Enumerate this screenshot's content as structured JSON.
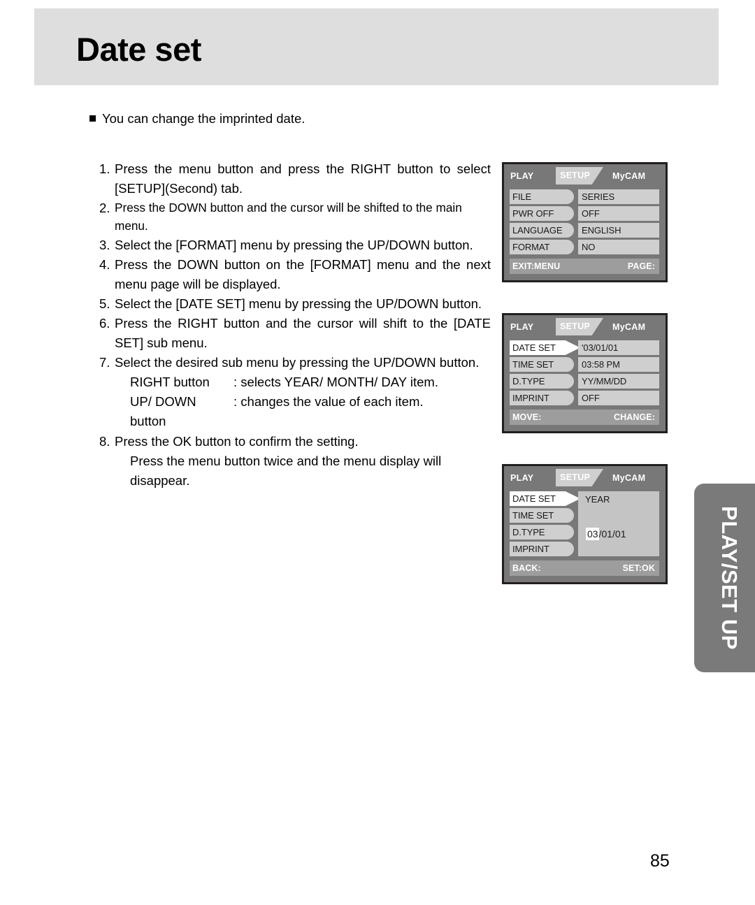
{
  "header": {
    "title": "Date set"
  },
  "intro": {
    "bullet_icon": "square-bullet-icon",
    "text": "You can change the imprinted date."
  },
  "steps": [
    {
      "num": "1.",
      "lines": [
        "Press the menu button and press the RIGHT button to select",
        "[SETUP](Second) tab."
      ]
    },
    {
      "num": "2.",
      "lines": [
        "Press the DOWN button and the cursor will be shifted to the main menu."
      ]
    },
    {
      "num": "3.",
      "lines": [
        "Select the [FORMAT] menu by pressing the UP/DOWN button."
      ]
    },
    {
      "num": "4.",
      "lines": [
        "Press the DOWN button on the [FORMAT] menu and the next",
        "menu page will be displayed."
      ]
    },
    {
      "num": "5.",
      "lines": [
        "Select the [DATE SET] menu by pressing the UP/DOWN button."
      ]
    },
    {
      "num": "6.",
      "lines": [
        "Press the RIGHT button and the cursor will shift to the [DATE",
        "SET] sub menu."
      ]
    },
    {
      "num": "7.",
      "lines": [
        "Select the desired sub menu by pressing the UP/DOWN button."
      ],
      "sub": [
        {
          "label": "RIGHT button",
          "value": ": selects YEAR/ MONTH/ DAY item."
        },
        {
          "label": "UP/ DOWN button",
          "value": ": changes the value of each item."
        }
      ]
    },
    {
      "num": "8.",
      "lines": [
        "Press the OK button to confirm the setting."
      ],
      "cont": [
        "Press the menu button twice and the menu display will disappear."
      ]
    }
  ],
  "lcd_screens": [
    {
      "id": "setup-page-1",
      "tabs": {
        "play": "PLAY",
        "setup": "SETUP",
        "mycam": "MyCAM"
      },
      "rows": [
        {
          "label": "FILE",
          "value": "SERIES",
          "selected": false
        },
        {
          "label": "PWR OFF",
          "value": "OFF",
          "selected": false
        },
        {
          "label": "LANGUAGE",
          "value": "ENGLISH",
          "selected": false
        },
        {
          "label": "FORMAT",
          "value": "NO",
          "selected": false
        }
      ],
      "footer": {
        "left": "EXIT:MENU",
        "right": "PAGE:"
      }
    },
    {
      "id": "setup-page-2",
      "tabs": {
        "play": "PLAY",
        "setup": "SETUP",
        "mycam": "MyCAM"
      },
      "rows": [
        {
          "label": "DATE SET",
          "value": "'03/01/01",
          "selected": true
        },
        {
          "label": "TIME SET",
          "value": "03:58 PM",
          "selected": false
        },
        {
          "label": "D.TYPE",
          "value": "YY/MM/DD",
          "selected": false
        },
        {
          "label": "IMPRINT",
          "value": "OFF",
          "selected": false
        }
      ],
      "footer": {
        "left": "MOVE:",
        "right": "CHANGE:"
      }
    },
    {
      "id": "date-set-submenu",
      "tabs": {
        "play": "PLAY",
        "setup": "SETUP",
        "mycam": "MyCAM"
      },
      "rows": [
        {
          "label": "DATE SET",
          "selected": true
        },
        {
          "label": "TIME SET",
          "selected": false
        },
        {
          "label": "D.TYPE",
          "selected": false
        },
        {
          "label": "IMPRINT",
          "selected": false
        }
      ],
      "panel": {
        "title": "YEAR",
        "highlighted_value": "03",
        "rest_value": "/01/01"
      },
      "footer": {
        "left": "BACK:",
        "right": "SET:OK"
      }
    }
  ],
  "side_tab": {
    "label": "PLAY/SET UP"
  },
  "footer": {
    "page_number": "85"
  },
  "colors": {
    "header_bg": "#dedede",
    "lcd_bg": "#787878",
    "lcd_item_bg": "#cfcfcf",
    "lcd_footer_bg": "#9d9d9d",
    "side_tab_bg": "#7a7a7a",
    "highlight": "#ffffff"
  }
}
